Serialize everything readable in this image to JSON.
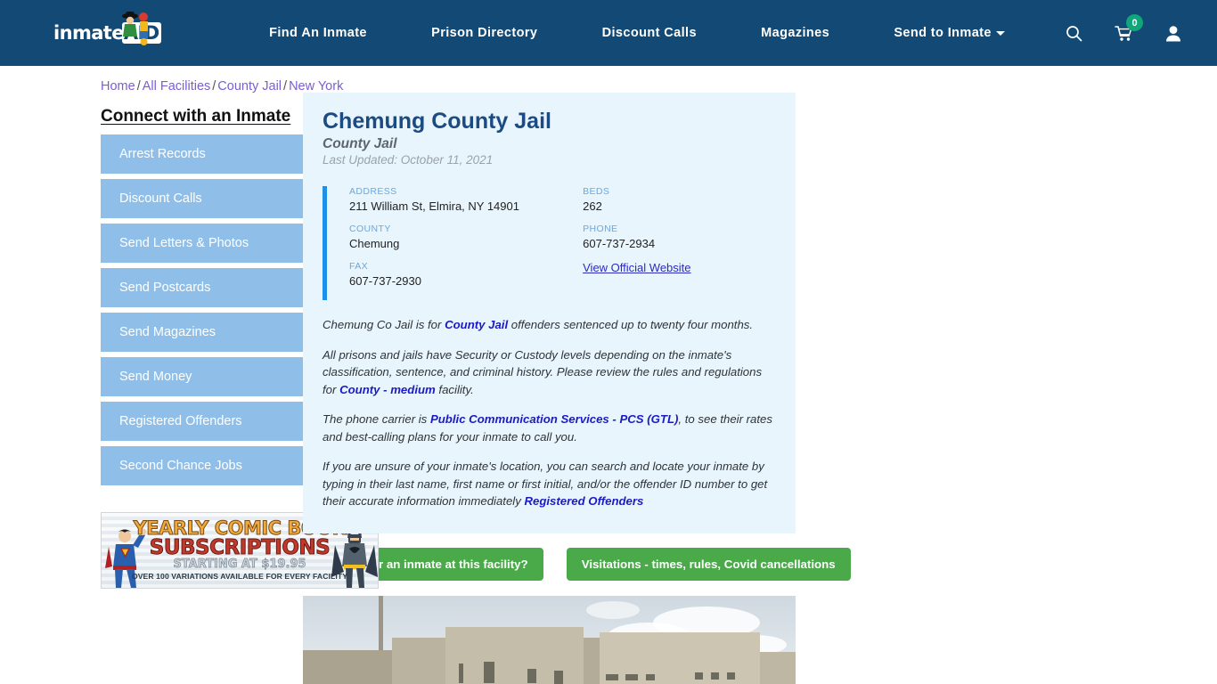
{
  "header": {
    "brand": {
      "text_main": "inmate",
      "text_accent": "AID",
      "icon": "inmateaid-logo"
    },
    "nav": [
      {
        "label": "Find An Inmate",
        "dropdown": false
      },
      {
        "label": "Prison Directory",
        "dropdown": false
      },
      {
        "label": "Discount Calls",
        "dropdown": false
      },
      {
        "label": "Magazines",
        "dropdown": false
      },
      {
        "label": "Send to Inmate",
        "dropdown": true
      }
    ],
    "icons": {
      "search": "search-icon",
      "cart": "shopping-cart-icon",
      "cart_count": "0",
      "account": "user-account-icon"
    },
    "bg_color": "#124a75",
    "badge_color": "#11a57a"
  },
  "breadcrumb": {
    "items": [
      "Home",
      "All Facilities",
      "County Jail",
      "New York"
    ],
    "separator": "/"
  },
  "sidebar": {
    "heading": "Connect with an Inmate",
    "items": [
      {
        "label": "Arrest Records",
        "active": true
      },
      {
        "label": "Discount Calls",
        "active": false
      },
      {
        "label": "Send Letters & Photos",
        "active": false
      },
      {
        "label": "Send Postcards",
        "active": false
      },
      {
        "label": "Send Magazines",
        "active": false
      },
      {
        "label": "Send Money",
        "active": false
      },
      {
        "label": "Registered Offenders",
        "active": false
      },
      {
        "label": "Second Chance Jobs",
        "active": false
      }
    ]
  },
  "ad": {
    "line1": "YEARLY COMIC BOOK",
    "line2": "SUBSCRIPTIONS",
    "line3": "STARTING AT $19.95",
    "line4": "OVER 100 VARIATIONS AVAILABLE FOR EVERY FACILITY"
  },
  "facility": {
    "title": "Chemung County Jail",
    "subtitle": "County Jail",
    "last_updated": "Last Updated: October 11, 2021",
    "info": {
      "address_label": "ADDRESS",
      "address_value": "211 William St, Elmira, NY 14901",
      "county_label": "COUNTY",
      "county_value": "Chemung",
      "fax_label": "FAX",
      "fax_value": "607-737-2930",
      "beds_label": "BEDS",
      "beds_value": "262",
      "phone_label": "PHONE",
      "phone_value": "607-737-2934",
      "website_link": "View Official Website"
    },
    "paragraphs": {
      "p1_a": "Chemung Co Jail is for ",
      "p1_link": "County Jail",
      "p1_b": " offenders sentenced up to twenty four months.",
      "p2_a": "All prisons and jails have Security or Custody levels depending on the inmate's classification, sentence, and criminal history. Please review the rules and regulations for ",
      "p2_link": "County - medium",
      "p2_b": " facility.",
      "p3_a": "The phone carrier is ",
      "p3_link": "Public Communication Services - PCS (GTL)",
      "p3_b": ", to see their rates and best-calling plans for your inmate to call you.",
      "p4_a": "If you are unsure of your inmate's location, you can search and locate your inmate by typing in their last name, first name or first initial, and/or the offender ID number to get their accurate information immediately ",
      "p4_link": "Registered Offenders"
    },
    "buttons": [
      {
        "label": "Looking for an inmate at this facility?"
      },
      {
        "label": "Visitations - times, rules, Covid cancellations"
      }
    ],
    "photo_alt": "facility-building-photo"
  },
  "colors": {
    "nav_bg": "#124a75",
    "card_bg": "#e9f5fc",
    "accent_bar": "#1e90e8",
    "title_blue": "#1b4b82",
    "sidebar_btn": "#8fbfe8",
    "sidebar_arrow": "#5b9bd5",
    "sidebar_arrow_active": "#1f4d79",
    "green_btn": "#4aaa4a",
    "link_purple": "#7b5ed0",
    "link_blue": "#1b1bc4"
  }
}
